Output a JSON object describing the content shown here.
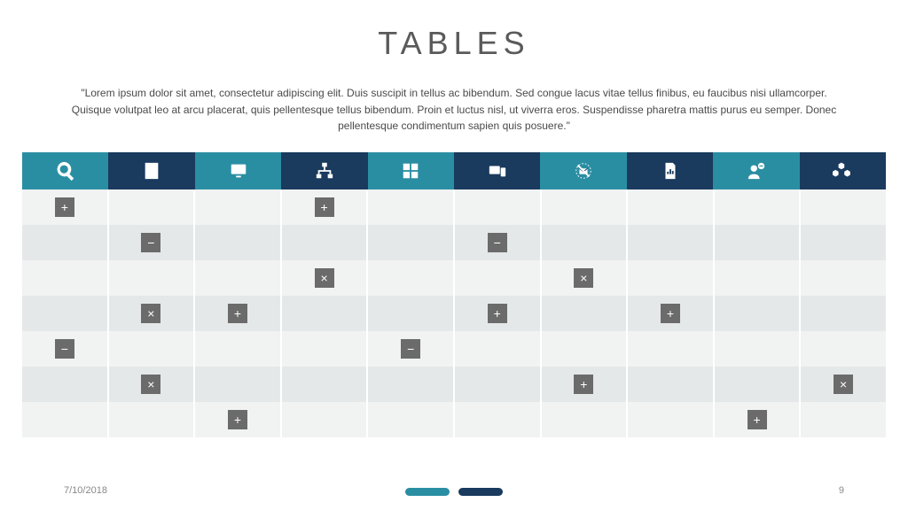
{
  "title": "TABLES",
  "description": "\"Lorem ipsum dolor sit amet, consectetur adipiscing elit. Duis suscipit in tellus ac bibendum. Sed congue lacus vitae tellus finibus, eu faucibus nisi ullamcorper. Quisque volutpat leo at arcu placerat,  quis pellentesque tellus bibendum. Proin et luctus nisl, ut viverra eros. Suspendisse pharetra mattis purus eu semper. Donec pellentesque condimentum sapien quis posuere.\"",
  "header": [
    {
      "icon": "search",
      "bg": "teal"
    },
    {
      "icon": "notebook",
      "bg": "navy"
    },
    {
      "icon": "monitor",
      "bg": "teal"
    },
    {
      "icon": "network",
      "bg": "navy"
    },
    {
      "icon": "grid",
      "bg": "teal"
    },
    {
      "icon": "devices",
      "bg": "navy"
    },
    {
      "icon": "mail-off",
      "bg": "teal"
    },
    {
      "icon": "chart-doc",
      "bg": "navy"
    },
    {
      "icon": "person-chat",
      "bg": "teal"
    },
    {
      "icon": "boxes",
      "bg": "navy"
    }
  ],
  "rows": [
    [
      "+",
      "",
      "",
      "+",
      "",
      "",
      "",
      "",
      "",
      ""
    ],
    [
      "",
      "-",
      "",
      "",
      "",
      "-",
      "",
      "",
      "",
      ""
    ],
    [
      "",
      "",
      "",
      "x",
      "",
      "",
      "x",
      "",
      "",
      " "
    ],
    [
      "",
      "x",
      "+",
      "",
      "",
      "+",
      "",
      "+",
      "",
      ""
    ],
    [
      "-",
      "",
      "",
      "",
      "-",
      "",
      "",
      "",
      "",
      ""
    ],
    [
      "",
      "x",
      "",
      "",
      "",
      "",
      "+",
      "",
      "",
      "x"
    ],
    [
      "",
      "",
      "+",
      "",
      "",
      "",
      "",
      "",
      "+",
      ""
    ]
  ],
  "footer": {
    "date": "7/10/2018",
    "page": "9"
  },
  "marks": {
    "+": "+",
    "-": "−",
    "x": "×"
  }
}
